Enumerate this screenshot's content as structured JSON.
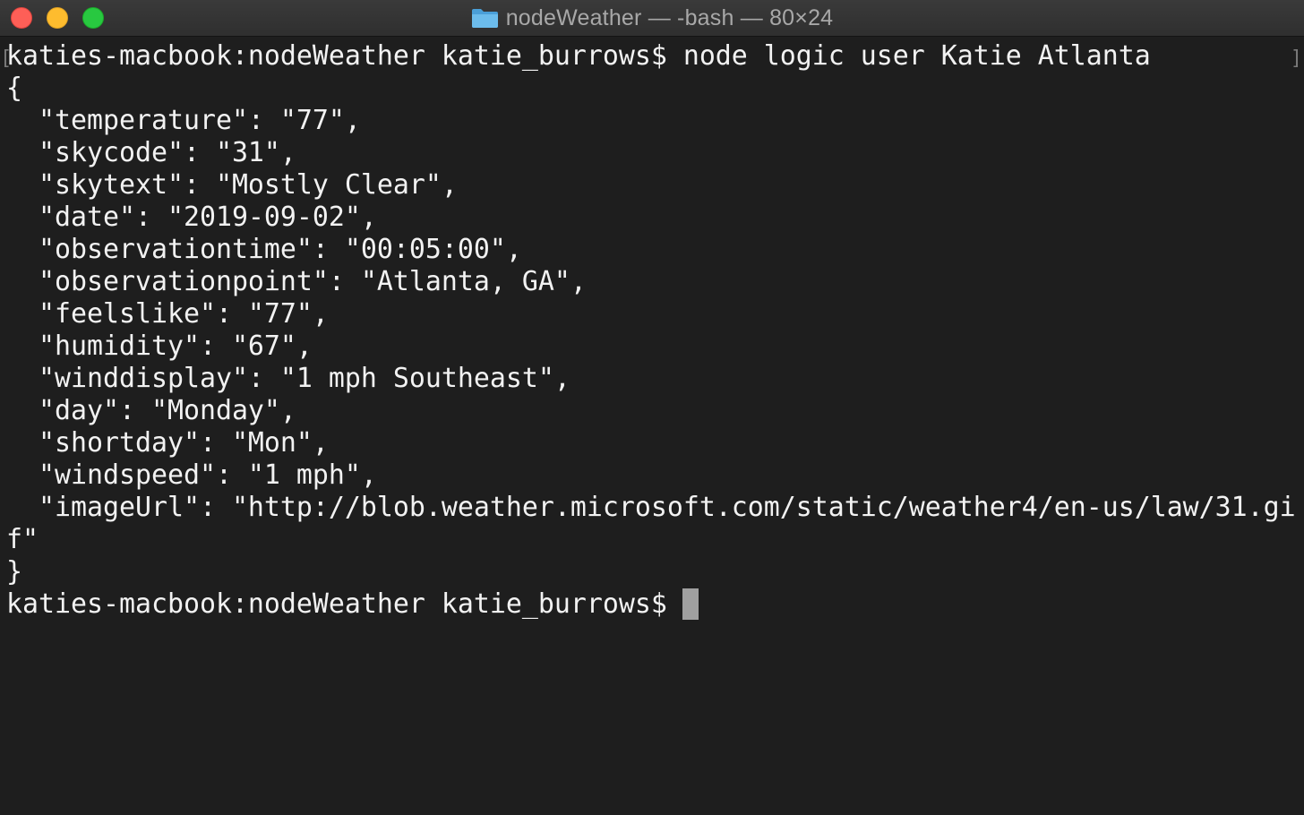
{
  "window": {
    "title": "nodeWeather — -bash — 80×24"
  },
  "terminal": {
    "lines": [
      "katies-macbook:nodeWeather katie_burrows$ node logic user Katie Atlanta",
      "{",
      "  \"temperature\": \"77\",",
      "  \"skycode\": \"31\",",
      "  \"skytext\": \"Mostly Clear\",",
      "  \"date\": \"2019-09-02\",",
      "  \"observationtime\": \"00:05:00\",",
      "  \"observationpoint\": \"Atlanta, GA\",",
      "  \"feelslike\": \"77\",",
      "  \"humidity\": \"67\",",
      "  \"winddisplay\": \"1 mph Southeast\",",
      "  \"day\": \"Monday\",",
      "  \"shortday\": \"Mon\",",
      "  \"windspeed\": \"1 mph\",",
      "  \"imageUrl\": \"http://blob.weather.microsoft.com/static/weather4/en-us/law/31.gi",
      "f\"",
      "}",
      "katies-macbook:nodeWeather katie_burrows$ "
    ]
  },
  "colors": {
    "background": "#1e1e1e",
    "text": "#f2f2f2",
    "cursor": "#a0a0a0",
    "close": "#fe5f57",
    "minimize": "#febc2e",
    "zoom": "#28c840",
    "folder": "#5fb1e6"
  },
  "icons": {
    "folder": "folder-icon",
    "cursor": "block-cursor"
  }
}
